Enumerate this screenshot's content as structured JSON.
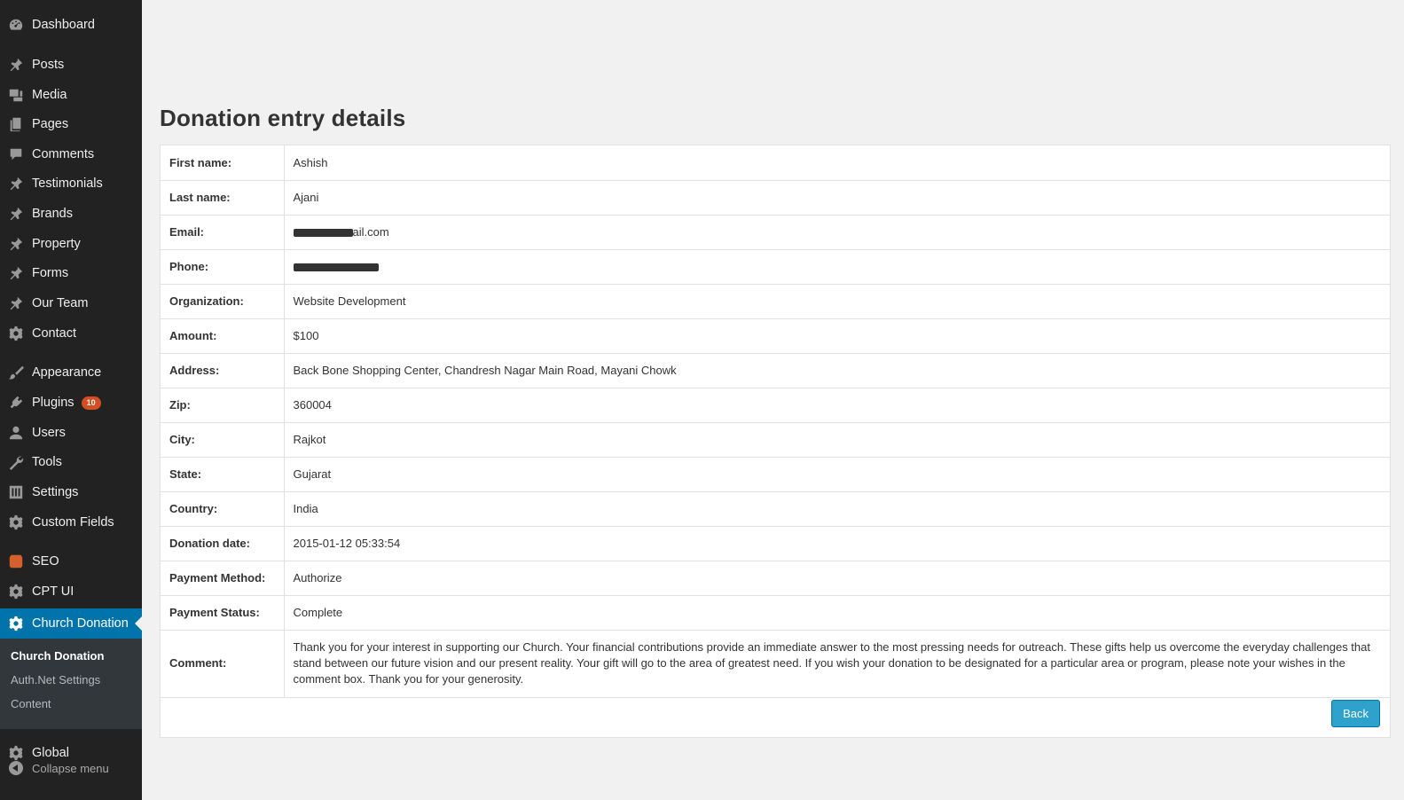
{
  "sidebar": {
    "items": [
      {
        "label": "Dashboard",
        "icon": "dashboard-icon"
      },
      {
        "label": "Posts",
        "icon": "pin-icon"
      },
      {
        "label": "Media",
        "icon": "media-icon"
      },
      {
        "label": "Pages",
        "icon": "pages-icon"
      },
      {
        "label": "Comments",
        "icon": "comments-icon"
      },
      {
        "label": "Testimonials",
        "icon": "pin-icon"
      },
      {
        "label": "Brands",
        "icon": "pin-icon"
      },
      {
        "label": "Property",
        "icon": "pin-icon"
      },
      {
        "label": "Forms",
        "icon": "pin-icon"
      },
      {
        "label": "Our Team",
        "icon": "pin-icon"
      },
      {
        "label": "Contact",
        "icon": "gear-icon"
      },
      {
        "label": "Appearance",
        "icon": "paintbrush-icon"
      },
      {
        "label": "Plugins",
        "icon": "plugin-icon",
        "badge": "10"
      },
      {
        "label": "Users",
        "icon": "user-icon"
      },
      {
        "label": "Tools",
        "icon": "wrench-icon"
      },
      {
        "label": "Settings",
        "icon": "settings-icon"
      },
      {
        "label": "Custom Fields",
        "icon": "gear-icon"
      },
      {
        "label": "SEO",
        "icon": "seo-icon"
      },
      {
        "label": "CPT UI",
        "icon": "gear-icon"
      },
      {
        "label": "Church Donation",
        "icon": "gear-icon"
      },
      {
        "label": "Global",
        "icon": "gear-icon"
      }
    ],
    "submenu": [
      "Church Donation",
      "Auth.Net Settings",
      "Content"
    ],
    "collapse_label": "Collapse menu"
  },
  "page": {
    "title": "Donation entry details",
    "back_label": "Back"
  },
  "details": [
    {
      "label": "First name:",
      "value": "Ashish"
    },
    {
      "label": "Last name:",
      "value": "Ajani"
    },
    {
      "label": "Email:",
      "value": "ail.com"
    },
    {
      "label": "Phone:",
      "value": ""
    },
    {
      "label": "Organization:",
      "value": "Website Development"
    },
    {
      "label": "Amount:",
      "value": "$100"
    },
    {
      "label": "Address:",
      "value": "Back Bone Shopping Center, Chandresh Nagar Main Road, Mayani Chowk"
    },
    {
      "label": "Zip:",
      "value": "360004"
    },
    {
      "label": "City:",
      "value": "Rajkot"
    },
    {
      "label": "State:",
      "value": "Gujarat"
    },
    {
      "label": "Country:",
      "value": "India"
    },
    {
      "label": "Donation date:",
      "value": "2015-01-12 05:33:54"
    },
    {
      "label": "Payment Method:",
      "value": "Authorize"
    },
    {
      "label": "Payment Status:",
      "value": "Complete"
    },
    {
      "label": "Comment:",
      "value": "Thank you for your interest in supporting our Church. Your financial contributions provide an immediate answer to the most pressing needs for outreach. These gifts help us overcome the everyday challenges that stand between our future vision and our present reality. Your gift will go to the area of greatest need. If you wish your donation to be designated for a particular area or program, please note your wishes in the comment box. Thank you for your generosity."
    }
  ],
  "colors": {
    "sidebar_bg": "#222222",
    "active": "#0073aa",
    "button": "#2ea2cc",
    "badge": "#d54e21"
  }
}
